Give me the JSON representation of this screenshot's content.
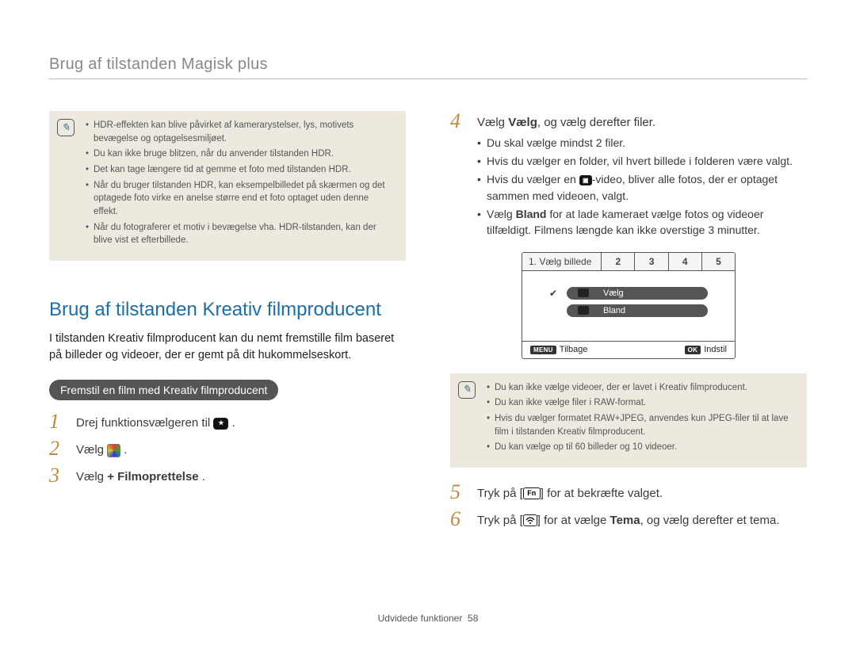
{
  "header": {
    "title": "Brug af tilstanden Magisk plus"
  },
  "left": {
    "note_items": [
      "HDR-effekten kan blive påvirket af kamerarystelser, lys, motivets bevægelse og optagelsesmiljøet.",
      "Du kan ikke bruge blitzen, når du anvender tilstanden HDR.",
      "Det kan tage længere tid at gemme et foto med tilstanden HDR.",
      "Når du bruger tilstanden HDR, kan eksempelbilledet på skærmen og det optagede foto virke en anelse større end et foto optaget uden denne effekt.",
      "Når du fotograferer et motiv i bevægelse vha. HDR-tilstanden, kan der blive vist et efterbillede."
    ],
    "section_heading": "Brug af tilstanden Kreativ filmproducent",
    "section_body": "I tilstanden Kreativ filmproducent kan du nemt fremstille film baseret på billeder og videoer, der er gemt på dit hukommelseskort.",
    "pill": "Fremstil en film med Kreativ filmproducent",
    "steps": {
      "s1_pre": "Drej funktionsvælgeren til ",
      "s1_post": ".",
      "s2_pre": "Vælg ",
      "s2_post": ".",
      "s3_pre": "Vælg ",
      "s3_bold": "+ Filmoprettelse",
      "s3_post": "."
    }
  },
  "right": {
    "step4": {
      "pre": "Vælg ",
      "bold": "Vælg",
      "post": ", og vælg derefter filer.",
      "bul1": "Du skal vælge mindst 2 filer.",
      "bul2": "Hvis du vælger en folder, vil hvert billede i folderen være valgt.",
      "bul3_pre": "Hvis du vælger en ",
      "bul3_post": "-video, bliver alle fotos, der er optaget sammen med videoen, valgt.",
      "bul4_pre": "Vælg ",
      "bul4_bold": "Bland",
      "bul4_post": " for at lade kameraet vælge fotos og videoer tilfældigt. Filmens længde kan ikke overstige 3 minutter."
    },
    "device": {
      "tab_active": "1. Vælg billede",
      "tabs": [
        "2",
        "3",
        "4",
        "5"
      ],
      "row1": "Vælg",
      "row2": "Bland",
      "back_key": "MENU",
      "back_label": "Tilbage",
      "set_key": "OK",
      "set_label": "Indstil"
    },
    "note_items": [
      "Du kan ikke vælge videoer, der er lavet i Kreativ filmproducent.",
      "Du kan ikke vælge filer i RAW-format.",
      "Hvis du vælger formatet RAW+JPEG, anvendes kun JPEG-filer til at lave film i tilstanden Kreativ filmproducent.",
      "Du kan vælge op til 60 billeder og 10 videoer."
    ],
    "step5": {
      "pre": "Tryk på [",
      "key": "Fn",
      "post": "] for at bekræfte valget."
    },
    "step6": {
      "pre": "Tryk på [",
      "mid": "] for at vælge ",
      "bold": "Tema",
      "post": ", og vælg derefter et tema."
    }
  },
  "footer": {
    "section": "Udvidede funktioner",
    "page": "58"
  }
}
